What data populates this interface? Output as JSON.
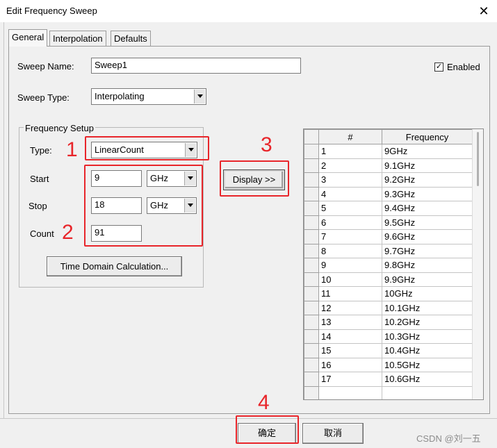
{
  "window": {
    "title": "Edit Frequency Sweep",
    "close": "✕"
  },
  "tabs": [
    {
      "label": "General"
    },
    {
      "label": "Interpolation"
    },
    {
      "label": "Defaults"
    }
  ],
  "general": {
    "sweep_name_label": "Sweep Name:",
    "sweep_name_value": "Sweep1",
    "sweep_type_label": "Sweep Type:",
    "sweep_type_value": "Interpolating",
    "enabled_label": "Enabled",
    "enabled_checked": "✓"
  },
  "frequency_setup": {
    "title": "Frequency Setup",
    "type_label": "Type:",
    "type_value": "LinearCount",
    "start_label": "Start",
    "start_value": "9",
    "start_unit": "GHz",
    "stop_label": "Stop",
    "stop_value": "18",
    "stop_unit": "GHz",
    "count_label": "Count",
    "count_value": "91",
    "time_domain_button": "Time Domain Calculation..."
  },
  "display_button": "Display >>",
  "table": {
    "headers": [
      "#",
      "Frequency"
    ],
    "rows": [
      {
        "n": "1",
        "f": "9GHz"
      },
      {
        "n": "2",
        "f": "9.1GHz"
      },
      {
        "n": "3",
        "f": "9.2GHz"
      },
      {
        "n": "4",
        "f": "9.3GHz"
      },
      {
        "n": "5",
        "f": "9.4GHz"
      },
      {
        "n": "6",
        "f": "9.5GHz"
      },
      {
        "n": "7",
        "f": "9.6GHz"
      },
      {
        "n": "8",
        "f": "9.7GHz"
      },
      {
        "n": "9",
        "f": "9.8GHz"
      },
      {
        "n": "10",
        "f": "9.9GHz"
      },
      {
        "n": "11",
        "f": "10GHz"
      },
      {
        "n": "12",
        "f": "10.1GHz"
      },
      {
        "n": "13",
        "f": "10.2GHz"
      },
      {
        "n": "14",
        "f": "10.3GHz"
      },
      {
        "n": "15",
        "f": "10.4GHz"
      },
      {
        "n": "16",
        "f": "10.5GHz"
      },
      {
        "n": "17",
        "f": "10.6GHz"
      },
      {
        "n": "",
        "f": ""
      }
    ]
  },
  "annotations": {
    "n1": "1",
    "n2": "2",
    "n3": "3",
    "n4": "4",
    "color": "#e8252a"
  },
  "buttons": {
    "ok": "确定",
    "cancel": "取消"
  },
  "watermark": "CSDN @刘一五"
}
